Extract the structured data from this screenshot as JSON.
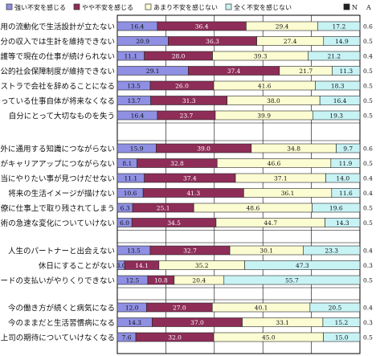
{
  "colors": {
    "strong": "#8f8fe3",
    "some": "#8e2d58",
    "little": "#fcfcd2",
    "none": "#c8f3f5"
  },
  "chart_data": {
    "type": "bar",
    "stacked": true,
    "orientation": "horizontal",
    "percent": true,
    "legend_position": "top",
    "series": [
      {
        "name": "強い不安を感じる",
        "color": "#8f8fe3",
        "values": [
          16.4,
          20.9,
          11.1,
          29.1,
          13.5,
          13.7,
          16.4,
          15.9,
          8.1,
          11.1,
          10.6,
          6.3,
          6.0,
          13.5,
          3.0,
          12.5,
          12.0,
          14.3,
          7.6
        ]
      },
      {
        "name": "やや不安を感じる",
        "color": "#8e2d58",
        "values": [
          36.4,
          36.3,
          28.0,
          37.4,
          26.0,
          31.3,
          23.7,
          39.0,
          32.8,
          37.4,
          41.3,
          25.1,
          34.5,
          32.7,
          14.1,
          10.8,
          27.0,
          37.0,
          32.0
        ]
      },
      {
        "name": "あまり不安を感じない",
        "color": "#fcfcd2",
        "values": [
          29.4,
          27.4,
          39.3,
          21.7,
          41.6,
          38.0,
          39.9,
          34.8,
          46.6,
          37.1,
          36.1,
          48.6,
          44.7,
          30.1,
          35.2,
          20.4,
          40.1,
          33.1,
          45.0
        ]
      },
      {
        "name": "全く不安を感じない",
        "color": "#c8f3f5",
        "values": [
          17.2,
          14.9,
          21.2,
          11.3,
          18.3,
          16.4,
          19.3,
          9.7,
          11.9,
          14.0,
          11.6,
          19.6,
          14.3,
          23.3,
          47.3,
          55.7,
          20.5,
          15.2,
          15.0
        ]
      }
    ],
    "categories": [
      "雇用の流動化で生活設計が立たない",
      "自分の収入では生計を維持できない",
      "介護等で現在の仕事が続けられない",
      "公的社会保障制度が維持できない",
      "リストラで会社を辞めることになる",
      "今やっている仕事自体が将来なくなる",
      "自分にとって大切なものを失う",
      "社外に通用する知識につながらない",
      "仕事がキャリアアップにつながらない",
      "本当にやりたい事が見つけだせない",
      "将来の生活イメージが描けない",
      "同僚に仕事上で取り残されてしまう",
      "技術の急速な変化についていけない",
      "人生のパートナーと出会えない",
      "休日にすることがない",
      "カードの支払いがやりくりできない",
      "今の働き方が続くと病気になる",
      "今のままだと生活習慣病になる",
      "上司の期待についていけなくなる"
    ],
    "groups": [
      [
        0,
        6
      ],
      [
        7,
        12
      ],
      [
        13,
        15
      ],
      [
        16,
        18
      ]
    ],
    "extra_columns": {
      "headers": [
        "N",
        "A"
      ],
      "A": [
        0.6,
        0.5,
        0.4,
        0.5,
        0.5,
        0.5,
        0.5,
        0.6,
        0.5,
        0.4,
        0.4,
        0.5,
        0.5,
        0.4,
        0.3,
        0.5,
        0.4,
        0.3,
        0.5
      ]
    },
    "xlim": [
      0,
      100
    ]
  }
}
